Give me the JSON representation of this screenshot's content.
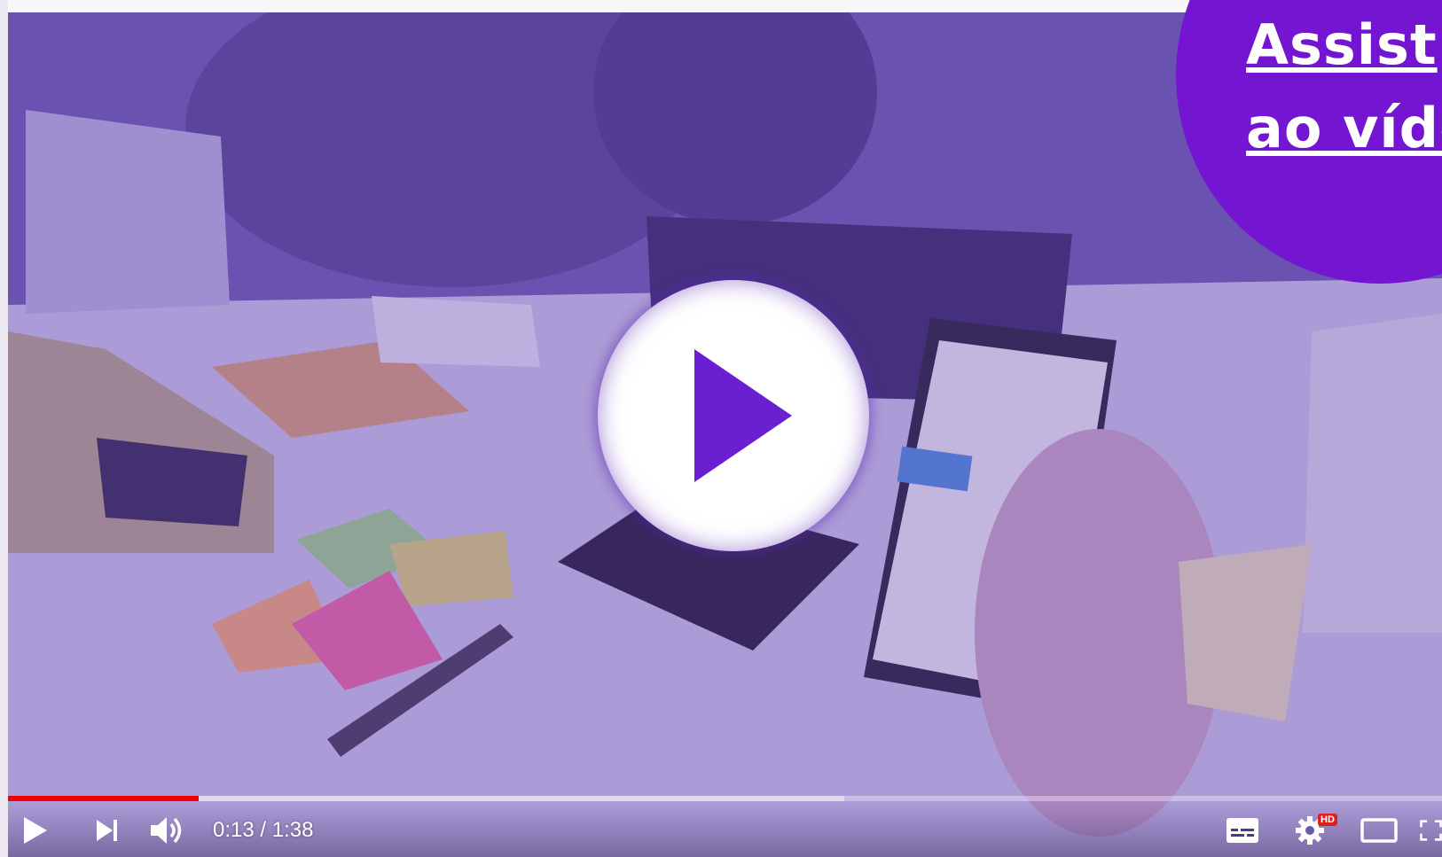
{
  "player": {
    "time_label": "0:13 / 1:38",
    "progress_played": 0.133,
    "progress_buffered": 0.583,
    "accent_color": "#f00000",
    "overlay_tint": "#5c36aa"
  },
  "badge": {
    "line1": "Assist",
    "line2": "ao víde",
    "color": "#7416d1"
  },
  "icons": {
    "big_play": "play-circle-icon",
    "play": "play-icon",
    "next": "next-icon",
    "volume": "volume-icon",
    "captions": "subtitles-icon",
    "settings": "gear-icon",
    "settings_badge": "HD",
    "theater": "theater-mode-icon",
    "fullscreen": "fullscreen-icon"
  }
}
